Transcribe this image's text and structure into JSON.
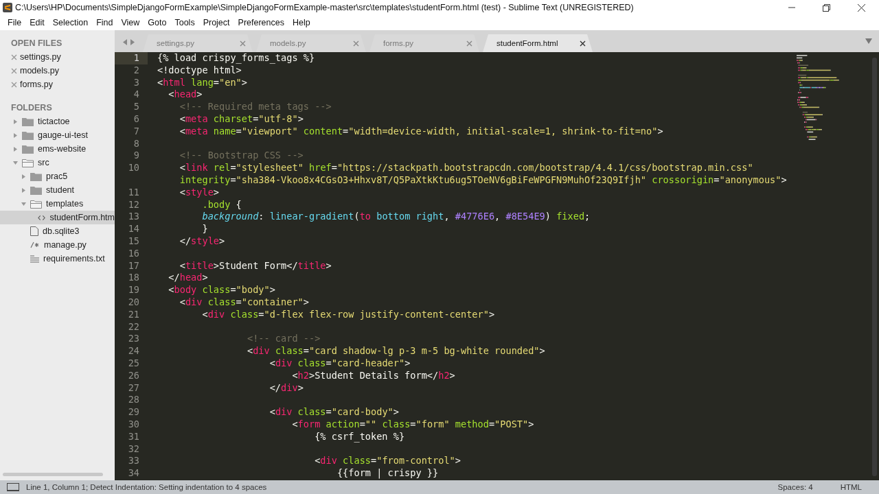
{
  "window": {
    "title": "C:\\Users\\HP\\Documents\\SimpleDjangoFormExample\\SimpleDjangoFormExample-master\\src\\templates\\studentForm.html (test) - Sublime Text (UNREGISTERED)"
  },
  "menu": [
    "File",
    "Edit",
    "Selection",
    "Find",
    "View",
    "Goto",
    "Tools",
    "Project",
    "Preferences",
    "Help"
  ],
  "sidebar": {
    "open_files_heading": "OPEN FILES",
    "open_files": [
      "settings.py",
      "models.py",
      "forms.py"
    ],
    "folders_heading": "FOLDERS",
    "folders": [
      {
        "name": "tictactoe",
        "kind": "folder",
        "expanded": false
      },
      {
        "name": "gauge-ui-test",
        "kind": "folder",
        "expanded": false
      },
      {
        "name": "ems-website",
        "kind": "folder",
        "expanded": false
      },
      {
        "name": "src",
        "kind": "folder",
        "expanded": true,
        "children": [
          {
            "name": "prac5",
            "kind": "folder",
            "expanded": false
          },
          {
            "name": "student",
            "kind": "folder",
            "expanded": false
          },
          {
            "name": "templates",
            "kind": "folder",
            "expanded": true,
            "children": [
              {
                "name": "studentForm.htm",
                "kind": "html",
                "selected": true
              }
            ]
          },
          {
            "name": "db.sqlite3",
            "kind": "file",
            "selected": false
          },
          {
            "name": "manage.py",
            "kind": "script",
            "selected": false
          },
          {
            "name": "requirements.txt",
            "kind": "text",
            "selected": false
          }
        ]
      }
    ]
  },
  "tabs": [
    {
      "label": "settings.py",
      "selected": false
    },
    {
      "label": "models.py",
      "selected": false
    },
    {
      "label": "forms.py",
      "selected": false
    },
    {
      "label": "studentForm.html",
      "selected": true
    }
  ],
  "editor": {
    "lines": [
      {
        "number": "1",
        "tokens": [
          {
            "kind": "p",
            "text": "{% load crispy_forms_tags %}"
          }
        ]
      },
      {
        "number": "2",
        "tokens": [
          {
            "kind": "p",
            "text": "<!doctype html>"
          }
        ]
      },
      {
        "number": "3",
        "tokens": [
          {
            "kind": "p",
            "text": "<"
          },
          {
            "kind": "tag",
            "text": "html"
          },
          {
            "kind": "attr",
            "text": " lang"
          },
          {
            "kind": "p",
            "text": "="
          },
          {
            "kind": "str",
            "text": "\"en\""
          },
          {
            "kind": "p",
            "text": ">"
          }
        ]
      },
      {
        "number": "4",
        "tokens": [
          {
            "kind": "p",
            "text": "  <"
          },
          {
            "kind": "tag",
            "text": "head"
          },
          {
            "kind": "p",
            "text": ">"
          }
        ]
      },
      {
        "number": "5",
        "tokens": [
          {
            "kind": "cmt",
            "text": "    <!-- Required meta tags -->"
          }
        ]
      },
      {
        "number": "6",
        "tokens": [
          {
            "kind": "p",
            "text": "    <"
          },
          {
            "kind": "tag",
            "text": "meta"
          },
          {
            "kind": "attr",
            "text": " charset"
          },
          {
            "kind": "p",
            "text": "="
          },
          {
            "kind": "str",
            "text": "\"utf-8\""
          },
          {
            "kind": "p",
            "text": ">"
          }
        ]
      },
      {
        "number": "7",
        "tokens": [
          {
            "kind": "p",
            "text": "    <"
          },
          {
            "kind": "tag",
            "text": "meta"
          },
          {
            "kind": "attr",
            "text": " name"
          },
          {
            "kind": "p",
            "text": "="
          },
          {
            "kind": "str",
            "text": "\"viewport\""
          },
          {
            "kind": "attr",
            "text": " content"
          },
          {
            "kind": "p",
            "text": "="
          },
          {
            "kind": "str",
            "text": "\"width=device-width, initial-scale=1, shrink-to-fit=no\""
          },
          {
            "kind": "p",
            "text": ">"
          }
        ]
      },
      {
        "number": "8"
      },
      {
        "number": "9",
        "tokens": [
          {
            "kind": "cmt",
            "text": "    <!-- Bootstrap CSS -->"
          }
        ]
      },
      {
        "number": "10",
        "tokens": [
          {
            "kind": "p",
            "text": "    <"
          },
          {
            "kind": "tag",
            "text": "link"
          },
          {
            "kind": "attr",
            "text": " rel"
          },
          {
            "kind": "p",
            "text": "="
          },
          {
            "kind": "str",
            "text": "\"stylesheet\""
          },
          {
            "kind": "attr",
            "text": " href"
          },
          {
            "kind": "p",
            "text": "="
          },
          {
            "kind": "str",
            "text": "\"https://stackpath.bootstrapcdn.com/bootstrap/4.4.1/css/bootstrap.min.css\""
          }
        ]
      },
      {
        "tokens": [
          {
            "kind": "attr",
            "text": "    integrity"
          },
          {
            "kind": "p",
            "text": "="
          },
          {
            "kind": "str",
            "text": "\"sha384-Vkoo8x4CGsO3+Hhxv8T/Q5PaXtkKtu6ug5TOeNV6gBiFeWPGFN9MuhOf23Q9Ifjh\""
          },
          {
            "kind": "attr",
            "text": " crossorigin"
          },
          {
            "kind": "p",
            "text": "="
          },
          {
            "kind": "str",
            "text": "\"anonymous\""
          },
          {
            "kind": "p",
            "text": ">"
          }
        ]
      },
      {
        "number": "11",
        "tokens": [
          {
            "kind": "p",
            "text": "    <"
          },
          {
            "kind": "tag",
            "text": "style"
          },
          {
            "kind": "p",
            "text": ">"
          }
        ]
      },
      {
        "number": "12",
        "tokens": [
          {
            "kind": "attr",
            "text": "        .body"
          },
          {
            "kind": "p",
            "text": " {"
          }
        ]
      },
      {
        "number": "13",
        "tokens": [
          {
            "kind": "prop",
            "text": "        background"
          },
          {
            "kind": "p",
            "text": ": "
          },
          {
            "kind": "fn",
            "text": "linear-gradient"
          },
          {
            "kind": "p",
            "text": "("
          },
          {
            "kind": "tag",
            "text": "to"
          },
          {
            "kind": "fn",
            "text": " bottom right"
          },
          {
            "kind": "p",
            "text": ", "
          },
          {
            "kind": "hex",
            "text": "#4776E6"
          },
          {
            "kind": "p",
            "text": ", "
          },
          {
            "kind": "hex",
            "text": "#8E54E9"
          },
          {
            "kind": "p",
            "text": ") "
          },
          {
            "kind": "attr",
            "text": "fixed"
          },
          {
            "kind": "p",
            "text": ";"
          }
        ]
      },
      {
        "number": "14",
        "tokens": [
          {
            "kind": "p",
            "text": "        }"
          }
        ]
      },
      {
        "number": "15",
        "tokens": [
          {
            "kind": "p",
            "text": "    </"
          },
          {
            "kind": "tag",
            "text": "style"
          },
          {
            "kind": "p",
            "text": ">"
          }
        ]
      },
      {
        "number": "16"
      },
      {
        "number": "17",
        "tokens": [
          {
            "kind": "p",
            "text": "    <"
          },
          {
            "kind": "tag",
            "text": "title"
          },
          {
            "kind": "p",
            "text": ">Student Form</"
          },
          {
            "kind": "tag",
            "text": "title"
          },
          {
            "kind": "p",
            "text": ">"
          }
        ]
      },
      {
        "number": "18",
        "tokens": [
          {
            "kind": "p",
            "text": "  </"
          },
          {
            "kind": "tag",
            "text": "head"
          },
          {
            "kind": "p",
            "text": ">"
          }
        ]
      },
      {
        "number": "19",
        "tokens": [
          {
            "kind": "p",
            "text": "  <"
          },
          {
            "kind": "tag",
            "text": "body"
          },
          {
            "kind": "attr",
            "text": " class"
          },
          {
            "kind": "p",
            "text": "="
          },
          {
            "kind": "str",
            "text": "\"body\""
          },
          {
            "kind": "p",
            "text": ">"
          }
        ]
      },
      {
        "number": "20",
        "tokens": [
          {
            "kind": "p",
            "text": "    <"
          },
          {
            "kind": "tag",
            "text": "div"
          },
          {
            "kind": "attr",
            "text": " class"
          },
          {
            "kind": "p",
            "text": "="
          },
          {
            "kind": "str",
            "text": "\"container\""
          },
          {
            "kind": "p",
            "text": ">"
          }
        ]
      },
      {
        "number": "21",
        "tokens": [
          {
            "kind": "p",
            "text": "        <"
          },
          {
            "kind": "tag",
            "text": "div"
          },
          {
            "kind": "attr",
            "text": " class"
          },
          {
            "kind": "p",
            "text": "="
          },
          {
            "kind": "str",
            "text": "\"d-flex flex-row justify-content-center\""
          },
          {
            "kind": "p",
            "text": ">"
          }
        ]
      },
      {
        "number": "22"
      },
      {
        "number": "23",
        "tokens": [
          {
            "kind": "cmt",
            "text": "                <!-- card -->"
          }
        ]
      },
      {
        "number": "24",
        "tokens": [
          {
            "kind": "p",
            "text": "                <"
          },
          {
            "kind": "tag",
            "text": "div"
          },
          {
            "kind": "attr",
            "text": " class"
          },
          {
            "kind": "p",
            "text": "="
          },
          {
            "kind": "str",
            "text": "\"card shadow-lg p-3 m-5 bg-white rounded\""
          },
          {
            "kind": "p",
            "text": ">"
          }
        ]
      },
      {
        "number": "25",
        "tokens": [
          {
            "kind": "p",
            "text": "                    <"
          },
          {
            "kind": "tag",
            "text": "div"
          },
          {
            "kind": "attr",
            "text": " class"
          },
          {
            "kind": "p",
            "text": "="
          },
          {
            "kind": "str",
            "text": "\"card-header\""
          },
          {
            "kind": "p",
            "text": ">"
          }
        ]
      },
      {
        "number": "26",
        "tokens": [
          {
            "kind": "p",
            "text": "                        <"
          },
          {
            "kind": "tag",
            "text": "h2"
          },
          {
            "kind": "p",
            "text": ">Student Details form</"
          },
          {
            "kind": "tag",
            "text": "h2"
          },
          {
            "kind": "p",
            "text": ">"
          }
        ]
      },
      {
        "number": "27",
        "tokens": [
          {
            "kind": "p",
            "text": "                    </"
          },
          {
            "kind": "tag",
            "text": "div"
          },
          {
            "kind": "p",
            "text": ">"
          }
        ]
      },
      {
        "number": "28"
      },
      {
        "number": "29",
        "tokens": [
          {
            "kind": "p",
            "text": "                    <"
          },
          {
            "kind": "tag",
            "text": "div"
          },
          {
            "kind": "attr",
            "text": " class"
          },
          {
            "kind": "p",
            "text": "="
          },
          {
            "kind": "str",
            "text": "\"card-body\""
          },
          {
            "kind": "p",
            "text": ">"
          }
        ]
      },
      {
        "number": "30",
        "tokens": [
          {
            "kind": "p",
            "text": "                        <"
          },
          {
            "kind": "tag",
            "text": "form"
          },
          {
            "kind": "attr",
            "text": " action"
          },
          {
            "kind": "p",
            "text": "="
          },
          {
            "kind": "str",
            "text": "\"\""
          },
          {
            "kind": "attr",
            "text": " class"
          },
          {
            "kind": "p",
            "text": "="
          },
          {
            "kind": "str",
            "text": "\"form\""
          },
          {
            "kind": "attr",
            "text": " method"
          },
          {
            "kind": "p",
            "text": "="
          },
          {
            "kind": "str",
            "text": "\"POST\""
          },
          {
            "kind": "p",
            "text": ">"
          }
        ]
      },
      {
        "number": "31",
        "tokens": [
          {
            "kind": "p",
            "text": "                            {% csrf_token %}"
          }
        ]
      },
      {
        "number": "32"
      },
      {
        "number": "33",
        "tokens": [
          {
            "kind": "p",
            "text": "                            <"
          },
          {
            "kind": "tag",
            "text": "div"
          },
          {
            "kind": "attr",
            "text": " class"
          },
          {
            "kind": "p",
            "text": "="
          },
          {
            "kind": "str",
            "text": "\"from-control\""
          },
          {
            "kind": "p",
            "text": ">"
          }
        ]
      },
      {
        "number": "34",
        "tokens": [
          {
            "kind": "p",
            "text": "                                {{form | crispy }}"
          }
        ]
      }
    ]
  },
  "status_bar": {
    "message": "Line 1, Column 1; Detect Indentation: Setting indentation to 4 spaces",
    "indentation": "Spaces: 4",
    "syntax": "HTML"
  }
}
